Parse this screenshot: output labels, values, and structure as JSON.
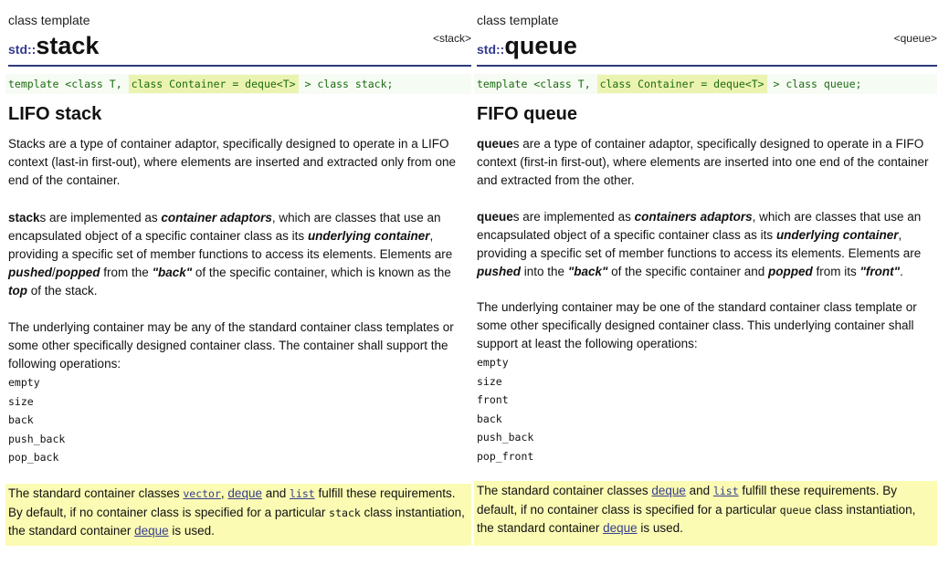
{
  "stack": {
    "kind": "class template",
    "header": "<stack>",
    "ns": "std::",
    "name": "stack",
    "decl": {
      "pre": "template <class T, ",
      "hl": "class Container = deque<T>",
      "post": " > class stack;"
    },
    "heading": "LIFO stack",
    "p1": "Stacks are a type of container adaptor, specifically designed to operate in a LIFO context (last-in first-out), where elements are inserted and extracted only from one end of the container.",
    "p2": {
      "t1": "stack",
      "t2": "s are implemented as ",
      "t3": "container adaptors",
      "t4": ", which are classes that use an encapsulated object of a specific container class as its ",
      "t5": "underlying container",
      "t6": ", providing a specific set of member functions to access its elements. Elements are ",
      "t7": "pushed",
      "t8": "/",
      "t9": "popped",
      "t10": " from the ",
      "t11": "\"back\"",
      "t12": " of the specific container, which is known as the ",
      "t13": "top",
      "t14": " of the stack."
    },
    "p3": "The underlying container may be any of the standard container class templates or some other specifically designed container class. The container shall support the following operations:",
    "ops": [
      "empty",
      "size",
      "back",
      "push_back",
      "pop_back"
    ],
    "note": {
      "t1": "The standard container classes ",
      "l1": "vector",
      "t2": ", ",
      "l2": "deque",
      "t3": " and ",
      "l3": "list",
      "t4": " fulfill these requirements. By default, if no container class is specified for a particular ",
      "c1": "stack",
      "t5": " class instantiation, the standard container ",
      "l4": "deque",
      "t6": " is used."
    }
  },
  "queue": {
    "kind": "class template",
    "header": "<queue>",
    "ns": "std::",
    "name": "queue",
    "decl": {
      "pre": "template <class T, ",
      "hl": "class Container = deque<T>",
      "post": " > class queue;"
    },
    "heading": "FIFO queue",
    "p1": {
      "t1": "queue",
      "t2": "s are a type of container adaptor, specifically designed to operate in a FIFO context (first-in first-out), where elements are inserted into one end of the container and extracted from the other."
    },
    "p2": {
      "t1": "queue",
      "t2": "s are implemented as ",
      "t3": "containers adaptors",
      "t4": ", which are classes that use an encapsulated object of a specific container class as its ",
      "t5": "underlying container",
      "t6": ", providing a specific set of member functions to access its elements. Elements are ",
      "t7": "pushed",
      "t8": " into the ",
      "t9": "\"back\"",
      "t10": " of the specific container and ",
      "t11": "popped",
      "t12": " from its ",
      "t13": "\"front\"",
      "t14": "."
    },
    "p3": "The underlying container may be one of the standard container class template or some other specifically designed container class. This underlying container shall support at least the following operations:",
    "ops": [
      "empty",
      "size",
      "front",
      "back",
      "push_back",
      "pop_front"
    ],
    "note": {
      "t1": "The standard container classes ",
      "l1": "deque",
      "t2": " and ",
      "l2": "list",
      "t3": " fulfill these requirements. By default, if no container class is specified for a particular ",
      "c1": "queue",
      "t4": " class instantiation, the standard container ",
      "l3": "deque",
      "t5": " is used."
    }
  }
}
